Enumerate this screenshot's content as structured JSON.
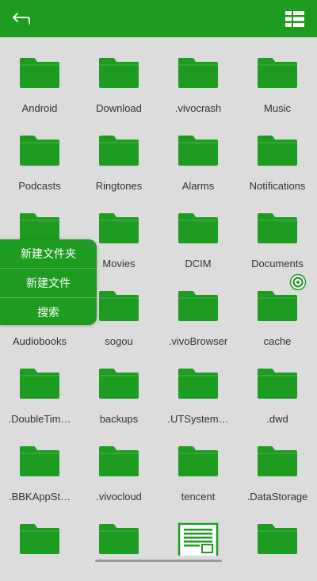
{
  "colors": {
    "accent": "#1e9b21",
    "background": "#dcdcdc",
    "label": "#333333"
  },
  "toolbar": {
    "back_icon": "back-arrow-icon",
    "view_icon": "view-toggle-icon"
  },
  "folders": [
    {
      "name": "Android"
    },
    {
      "name": "Download"
    },
    {
      "name": ".vivocrash"
    },
    {
      "name": "Music"
    },
    {
      "name": "Podcasts"
    },
    {
      "name": "Ringtones"
    },
    {
      "name": "Alarms"
    },
    {
      "name": "Notifications"
    },
    {
      "name": ""
    },
    {
      "name": "Movies"
    },
    {
      "name": "DCIM"
    },
    {
      "name": "Documents"
    },
    {
      "name": "Audiobooks"
    },
    {
      "name": "sogou"
    },
    {
      "name": ".vivoBrowser"
    },
    {
      "name": "cache"
    },
    {
      "name": ".DoubleTim…"
    },
    {
      "name": "backups"
    },
    {
      "name": ".UTSystem…"
    },
    {
      "name": ".dwd"
    },
    {
      "name": ".BBKAppSt…"
    },
    {
      "name": ".vivocloud"
    },
    {
      "name": "tencent"
    },
    {
      "name": ".DataStorage"
    },
    {
      "name": "",
      "type": "folder"
    },
    {
      "name": "",
      "type": "folder"
    },
    {
      "name": "",
      "type": "document"
    },
    {
      "name": "",
      "type": "folder"
    }
  ],
  "context_menu": {
    "new_folder": "新建文件夹",
    "new_file": "新建文件",
    "search": "搜索"
  }
}
